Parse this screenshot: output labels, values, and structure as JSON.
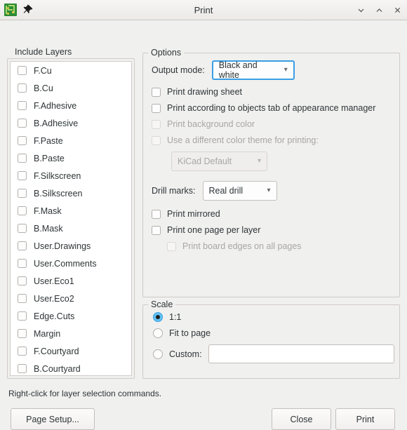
{
  "window": {
    "title": "Print",
    "app_icon": "pcb-board-icon",
    "pin_icon": "pin-icon",
    "controls": {
      "minimize": "⌄",
      "maximize": "⌃",
      "close": "✕"
    }
  },
  "include_layers": {
    "title": "Include Layers",
    "layers": [
      {
        "label": "F.Cu",
        "checked": false
      },
      {
        "label": "B.Cu",
        "checked": false
      },
      {
        "label": "F.Adhesive",
        "checked": false
      },
      {
        "label": "B.Adhesive",
        "checked": false
      },
      {
        "label": "F.Paste",
        "checked": false
      },
      {
        "label": "B.Paste",
        "checked": false
      },
      {
        "label": "F.Silkscreen",
        "checked": false
      },
      {
        "label": "B.Silkscreen",
        "checked": false
      },
      {
        "label": "F.Mask",
        "checked": false
      },
      {
        "label": "B.Mask",
        "checked": false
      },
      {
        "label": "User.Drawings",
        "checked": false
      },
      {
        "label": "User.Comments",
        "checked": false
      },
      {
        "label": "User.Eco1",
        "checked": false
      },
      {
        "label": "User.Eco2",
        "checked": false
      },
      {
        "label": "Edge.Cuts",
        "checked": false
      },
      {
        "label": "Margin",
        "checked": false
      },
      {
        "label": "F.Courtyard",
        "checked": false
      },
      {
        "label": "B.Courtyard",
        "checked": false
      }
    ]
  },
  "options": {
    "title": "Options",
    "output_mode_label": "Output mode:",
    "output_mode_value": "Black and white",
    "print_drawing_sheet": "Print drawing sheet",
    "print_according_objects": "Print according to objects tab of appearance manager",
    "print_background_color": "Print background color",
    "use_different_theme": "Use a different color theme for printing:",
    "theme_value": "KiCad Default",
    "drill_marks_label": "Drill marks:",
    "drill_marks_value": "Real drill",
    "print_mirrored": "Print mirrored",
    "print_one_page_per_layer": "Print one page per layer",
    "print_board_edges": "Print board edges on all pages"
  },
  "scale": {
    "title": "Scale",
    "option_1to1": "1:1",
    "option_fit": "Fit to page",
    "option_custom": "Custom:",
    "custom_value": "",
    "selected": "1:1"
  },
  "footer": {
    "hint": "Right-click for layer selection commands.",
    "page_setup": "Page Setup...",
    "close": "Close",
    "print": "Print"
  },
  "colors": {
    "background": "#f0f0ef",
    "focus_blue": "#3b9ee5",
    "radio_fill": "#62c2f2",
    "disabled_text": "#a9a6a3",
    "border": "#cfcbc7"
  }
}
